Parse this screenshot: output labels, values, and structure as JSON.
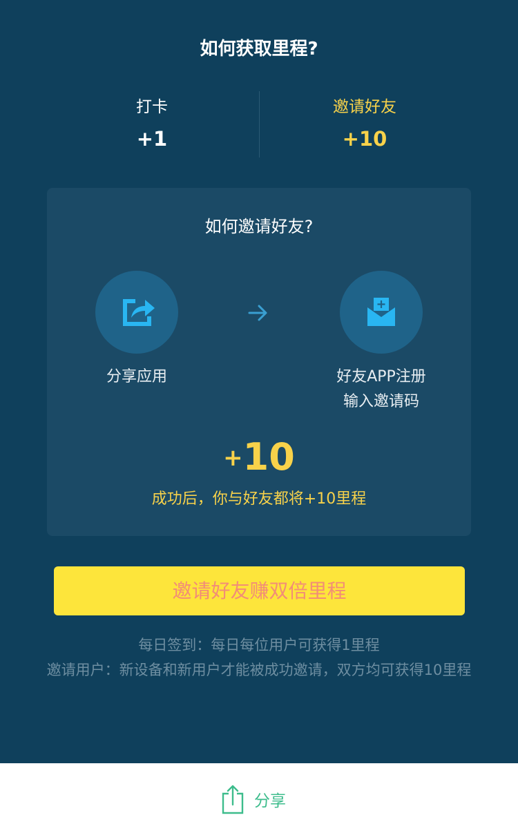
{
  "header": {
    "title": "如何获取里程?"
  },
  "stats": {
    "checkin": {
      "label": "打卡",
      "value": "+1"
    },
    "invite": {
      "label": "邀请好友",
      "value": "+10",
      "color": "#f8d24a"
    }
  },
  "invite_card": {
    "title": "如何邀请好友?",
    "step1": {
      "label": "分享应用",
      "icon": "share-icon"
    },
    "step2": {
      "line1": "好友APP注册",
      "line2": "输入邀请码",
      "icon": "envelope-plus-icon"
    },
    "reward": {
      "plus": "+",
      "number": "10",
      "description": "成功后，你与好友都将+10里程"
    }
  },
  "cta": {
    "label": "邀请好友赚双倍里程"
  },
  "rules": {
    "line1": "每日签到：每日每位用户可获得1里程",
    "line2": "邀请用户：新设备和新用户才能被成功邀请，双方均可获得10里程"
  },
  "footer": {
    "share_label": "分享",
    "icon": "share-upload-icon"
  },
  "colors": {
    "background": "#0f405c",
    "card": "#1b4a66",
    "accent_yellow": "#f8d24a",
    "button": "#fde53b",
    "button_text": "#f28d77",
    "share_green": "#3dbc8c"
  }
}
